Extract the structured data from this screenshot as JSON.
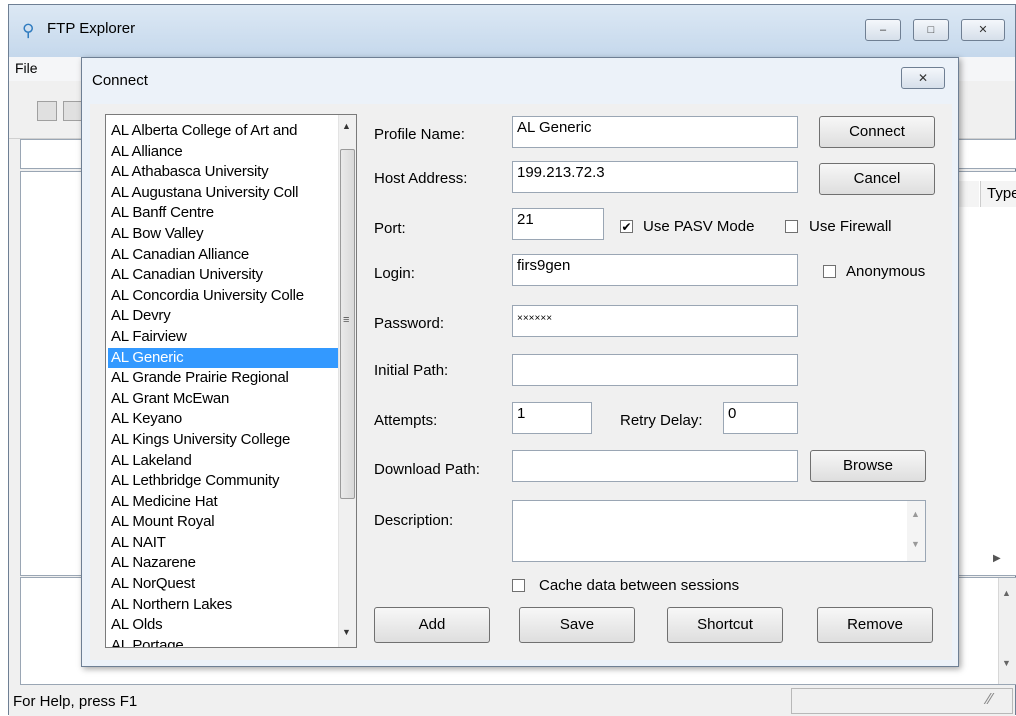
{
  "window": {
    "title": "FTP Explorer",
    "controls": {
      "minimize": "–",
      "maximize": "□",
      "close": "✕"
    }
  },
  "menu": {
    "file": "File"
  },
  "list_columns": {
    "type": "Type"
  },
  "status_bar": {
    "text": "For Help, press F1"
  },
  "dialog": {
    "title": "Connect",
    "close_glyph": "✕",
    "profiles": [
      "AL Alberta College of Art and",
      "AL Alliance",
      "AL Athabasca University",
      "AL Augustana University Coll",
      "AL Banff Centre",
      "AL Bow Valley",
      "AL Canadian Alliance",
      "AL Canadian University",
      "AL Concordia University Colle",
      "AL Devry",
      "AL Fairview",
      "AL Generic",
      "AL Grande Prairie Regional",
      "AL Grant McEwan",
      "AL Keyano",
      "AL Kings University College",
      "AL Lakeland",
      "AL Lethbridge Community",
      "AL Medicine Hat",
      "AL Mount Royal",
      "AL NAIT",
      "AL Nazarene",
      "AL NorQuest",
      "AL Northern Lakes",
      "AL Olds",
      "AL Portage"
    ],
    "selected_profile": "AL Generic",
    "fields": {
      "profile_name": {
        "label": "Profile Name:",
        "value": "AL Generic"
      },
      "host_address": {
        "label": "Host Address:",
        "value": "199.213.72.3"
      },
      "port": {
        "label": "Port:",
        "value": "21"
      },
      "login": {
        "label": "Login:",
        "value": "firs9gen"
      },
      "password": {
        "label": "Password:",
        "value": "××××××"
      },
      "initial_path": {
        "label": "Initial Path:",
        "value": ""
      },
      "attempts": {
        "label": "Attempts:",
        "value": "1"
      },
      "retry_delay": {
        "label": "Retry Delay:",
        "value": "0"
      },
      "download_path": {
        "label": "Download Path:",
        "value": ""
      },
      "description": {
        "label": "Description:",
        "value": ""
      }
    },
    "checkboxes": {
      "use_pasv_mode": {
        "label": "Use PASV Mode",
        "checked": true
      },
      "use_firewall": {
        "label": "Use Firewall",
        "checked": false
      },
      "anonymous": {
        "label": "Anonymous",
        "checked": false
      },
      "cache_data": {
        "label": "Cache data between sessions",
        "checked": false
      }
    },
    "buttons": {
      "connect": "Connect",
      "cancel": "Cancel",
      "browse": "Browse",
      "add": "Add",
      "save": "Save",
      "shortcut": "Shortcut",
      "remove": "Remove"
    }
  },
  "icons": {
    "app": "ftp-explorer-icon",
    "scroll_up": "▲",
    "scroll_down": "▼",
    "scroll_right": "▶",
    "check_mark": "✔",
    "grip": "≡",
    "resize": "∕∕"
  },
  "colors": {
    "selection": "#3399ff",
    "titlebar": "#c5d8ec",
    "dialog_frame": "#ecf2f9"
  }
}
